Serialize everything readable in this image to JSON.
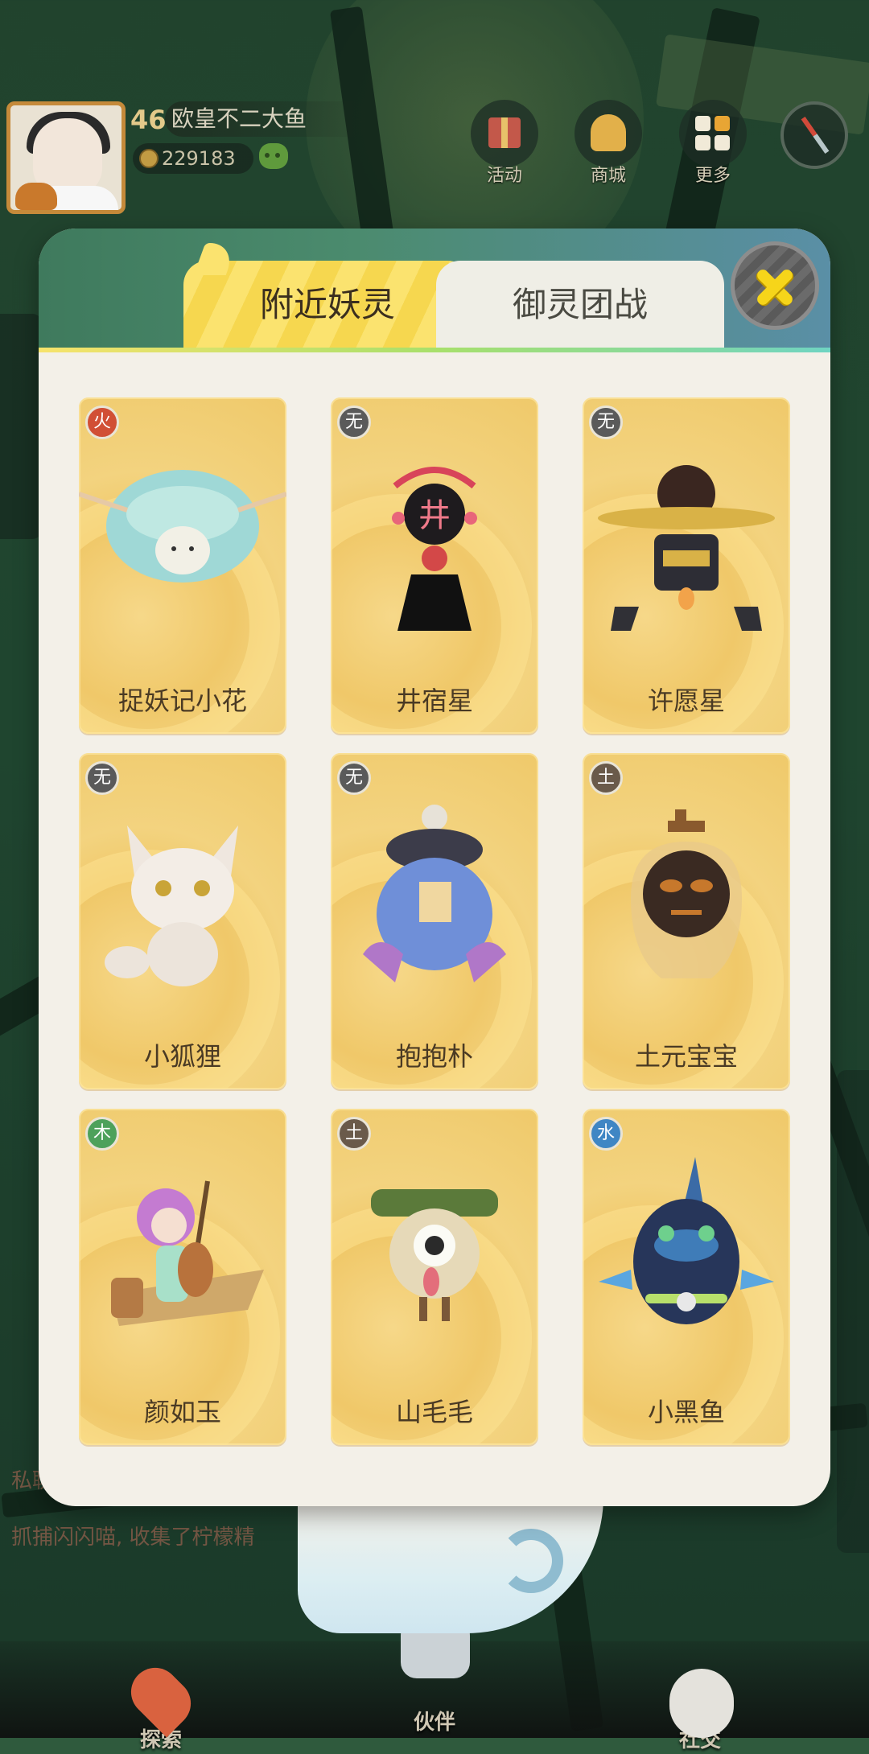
{
  "player": {
    "level": "46",
    "nickname": "欧皇不二大鱼",
    "coins": "229183"
  },
  "top_buttons": [
    {
      "label": "活动",
      "icon": "gift-icon"
    },
    {
      "label": "商城",
      "icon": "shop-icon"
    },
    {
      "label": "更多",
      "icon": "more-grid-icon"
    }
  ],
  "background_chat": {
    "line1": "私聊",
    "line2": "抓捕闪闪喵, 收集了柠檬精"
  },
  "modal": {
    "tabs": [
      {
        "label": "附近妖灵",
        "active": true
      },
      {
        "label": "御灵团战",
        "active": false
      }
    ],
    "close_icon": "close-x-icon",
    "cards": [
      {
        "name": "捉妖记小花",
        "element": "火",
        "element_type": "fire"
      },
      {
        "name": "井宿星",
        "element": "无",
        "element_type": "none"
      },
      {
        "name": "许愿星",
        "element": "无",
        "element_type": "none"
      },
      {
        "name": "小狐狸",
        "element": "无",
        "element_type": "none"
      },
      {
        "name": "抱抱朴",
        "element": "无",
        "element_type": "none"
      },
      {
        "name": "土元宝宝",
        "element": "土",
        "element_type": "earth"
      },
      {
        "name": "颜如玉",
        "element": "木",
        "element_type": "wood"
      },
      {
        "name": "山毛毛",
        "element": "土",
        "element_type": "earth"
      },
      {
        "name": "小黑鱼",
        "element": "水",
        "element_type": "water"
      }
    ]
  },
  "bottom_nav": [
    {
      "label": "探索",
      "icon": "map-pin-icon"
    },
    {
      "label": "伙伴",
      "icon": "ghost-companion-icon"
    },
    {
      "label": "社交",
      "icon": "social-icon"
    }
  ]
}
